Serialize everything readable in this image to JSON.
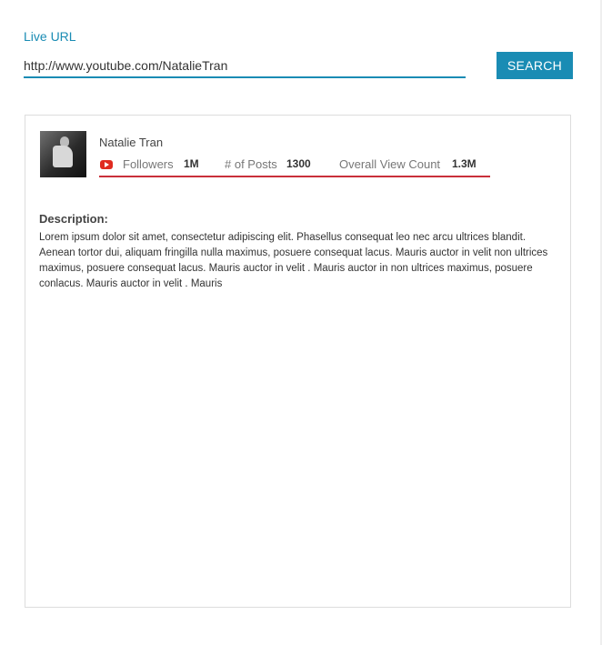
{
  "form": {
    "url_label": "Live URL",
    "url_value": "http://www.youtube.com/NatalieTran",
    "search_label": "SEARCH"
  },
  "profile": {
    "name": "Natalie Tran",
    "platform_icon": "youtube-icon",
    "stats": {
      "followers_label": "Followers",
      "followers_value": "1M",
      "posts_label": "# of Posts",
      "posts_value": "1300",
      "views_label": "Overall View Count",
      "views_value": "1.3M"
    },
    "description_heading": "Description:",
    "description_text": "Lorem ipsum dolor sit amet, consectetur adipiscing elit. Phasellus consequat leo nec arcu ultrices blandit. Aenean tortor dui, aliquam fringilla nulla maximus, posuere consequat lacus. Mauris auctor in velit non ultrices maximus, posuere consequat lacus. Mauris auctor in velit . Mauris auctor in non ultrices maximus, posuere conlacus. Mauris auctor in velit . Mauris"
  },
  "colors": {
    "accent": "#1a8cb4",
    "underline": "#c9303a",
    "youtube": "#e02b20"
  }
}
